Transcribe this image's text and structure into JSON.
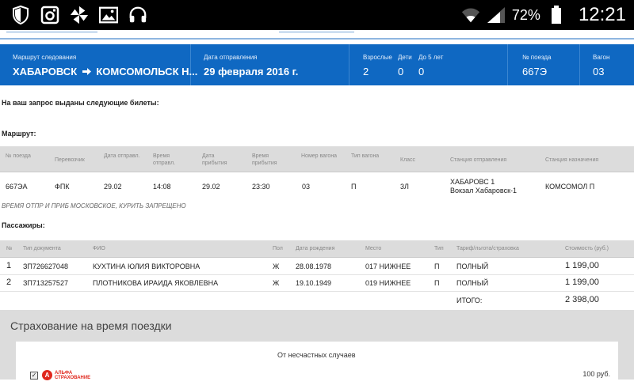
{
  "status_bar": {
    "icons": [
      "shield-icon",
      "instagram-icon",
      "pinwheel-icon",
      "gallery-icon",
      "headphones-icon"
    ],
    "battery": "72%",
    "time": "12:21"
  },
  "header": {
    "route_label": "Маршрут следования",
    "route_from": "ХАБАРОВСК",
    "route_to": "КОМСОМОЛЬСК Н...",
    "date_label": "Дата отправления",
    "date_value": "29 февраля 2016 г.",
    "adults_label": "Взрослые",
    "adults_value": "2",
    "children_label": "Дети",
    "children_value": "0",
    "under5_label": "До 5 лет",
    "under5_value": "0",
    "train_label": "№ поезда",
    "train_value": "667Э",
    "car_label": "Вагон",
    "car_value": "03"
  },
  "intro_text": "На ваш запрос выданы следующие билеты:",
  "route_heading": "Маршрут:",
  "route_table": {
    "headers": [
      "№ поезда",
      "Перевозчик",
      "Дата отправл.",
      "Время отправл.",
      "Дата прибытия",
      "Время прибытия",
      "Номер вагона",
      "Тип вагона",
      "Класс",
      "Станция отправления",
      "Станция назначения"
    ],
    "row": {
      "train": "667ЭА",
      "carrier": "ФПК",
      "dep_date": "29.02",
      "dep_time": "14:08",
      "arr_date": "29.02",
      "arr_time": "23:30",
      "car_no": "03",
      "car_type": "П",
      "class": "3Л",
      "dep_station_1": "ХАБАРОВС 1",
      "dep_station_2": "Вокзал Хабаровск-1",
      "arr_station": "КОМСОМОЛ П"
    },
    "note": "ВРЕМЯ ОТПР И ПРИБ МОСКОВСКОЕ, КУРИТЬ ЗАПРЕЩЕНО"
  },
  "passengers_heading": "Пассажиры:",
  "passengers_table": {
    "headers": [
      "№",
      "Тип документа",
      "ФИО",
      "Пол",
      "Дата рождения",
      "Место",
      "Тип",
      "Тариф/льгота/страховка",
      "Стоимость (руб.)"
    ],
    "rows": [
      {
        "n": "1",
        "doc": "ЗП726627048",
        "name": "КУХТИНА ЮЛИЯ ВИКТОРОВНА",
        "sex": "Ж",
        "birth": "28.08.1978",
        "seat": "017 НИЖНЕЕ",
        "type": "П",
        "tariff": "ПОЛНЫЙ",
        "price": "1 199,00"
      },
      {
        "n": "2",
        "doc": "ЗП713257527",
        "name": "ПЛОТНИКОВА ИРАИДА ЯКОВЛЕВНА",
        "sex": "Ж",
        "birth": "19.10.1949",
        "seat": "019 НИЖНЕЕ",
        "type": "П",
        "tariff": "ПОЛНЫЙ",
        "price": "1 199,00"
      }
    ],
    "total_label": "ИТОГО:",
    "total_value": "2 398,00"
  },
  "insurance": {
    "title": "Страхование на время поездки",
    "subtitle": "От несчастных случаев",
    "logo_text_1": "АЛЬФА",
    "logo_text_2": "СТРАХОВАНИЕ",
    "price": "100 руб.",
    "checked": true
  },
  "colors": {
    "header_blue": "#0f68c2",
    "table_head_gray": "#dcdcdc",
    "logo_red": "#e0271d"
  }
}
